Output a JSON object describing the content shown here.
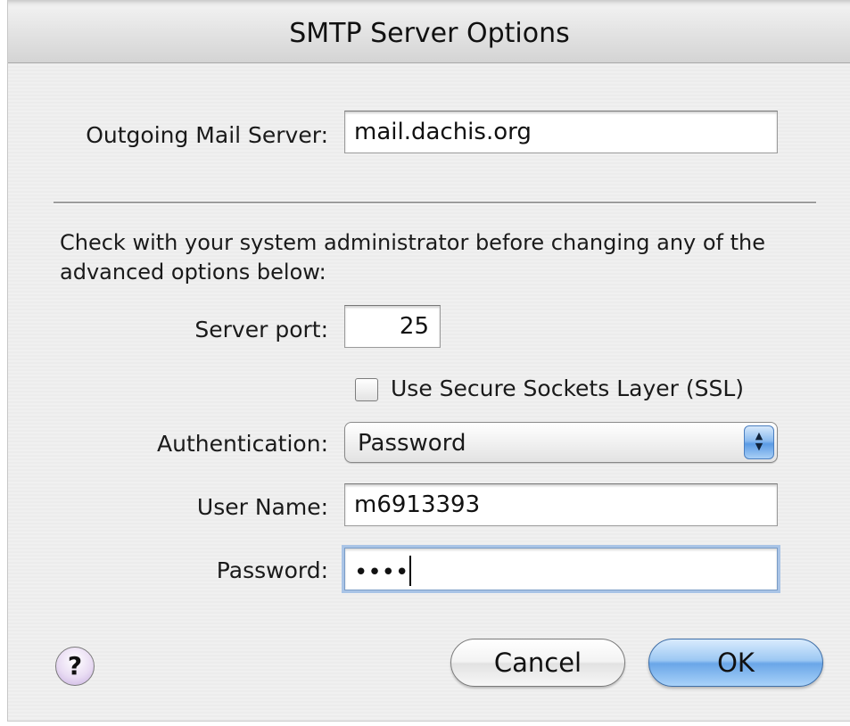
{
  "window": {
    "title": "SMTP Server Options"
  },
  "outgoing": {
    "label": "Outgoing Mail Server:",
    "value": "mail.dachis.org"
  },
  "notice": "Check with your system administrator before changing any of the advanced options below:",
  "port": {
    "label": "Server port:",
    "value": "25"
  },
  "ssl": {
    "label": "Use Secure Sockets Layer (SSL)",
    "checked": false
  },
  "authentication": {
    "label": "Authentication:",
    "selected": "Password",
    "arrows_icon": "up-down-arrows-icon"
  },
  "username": {
    "label": "User Name:",
    "value": "m6913393"
  },
  "password": {
    "label": "Password:",
    "masked_value": "••••"
  },
  "buttons": {
    "help": "?",
    "cancel": "Cancel",
    "ok": "OK"
  },
  "colors": {
    "default_button": "#6aa6e8",
    "focus_ring": "#a9c4e6",
    "help_button": "#c6aee0"
  }
}
